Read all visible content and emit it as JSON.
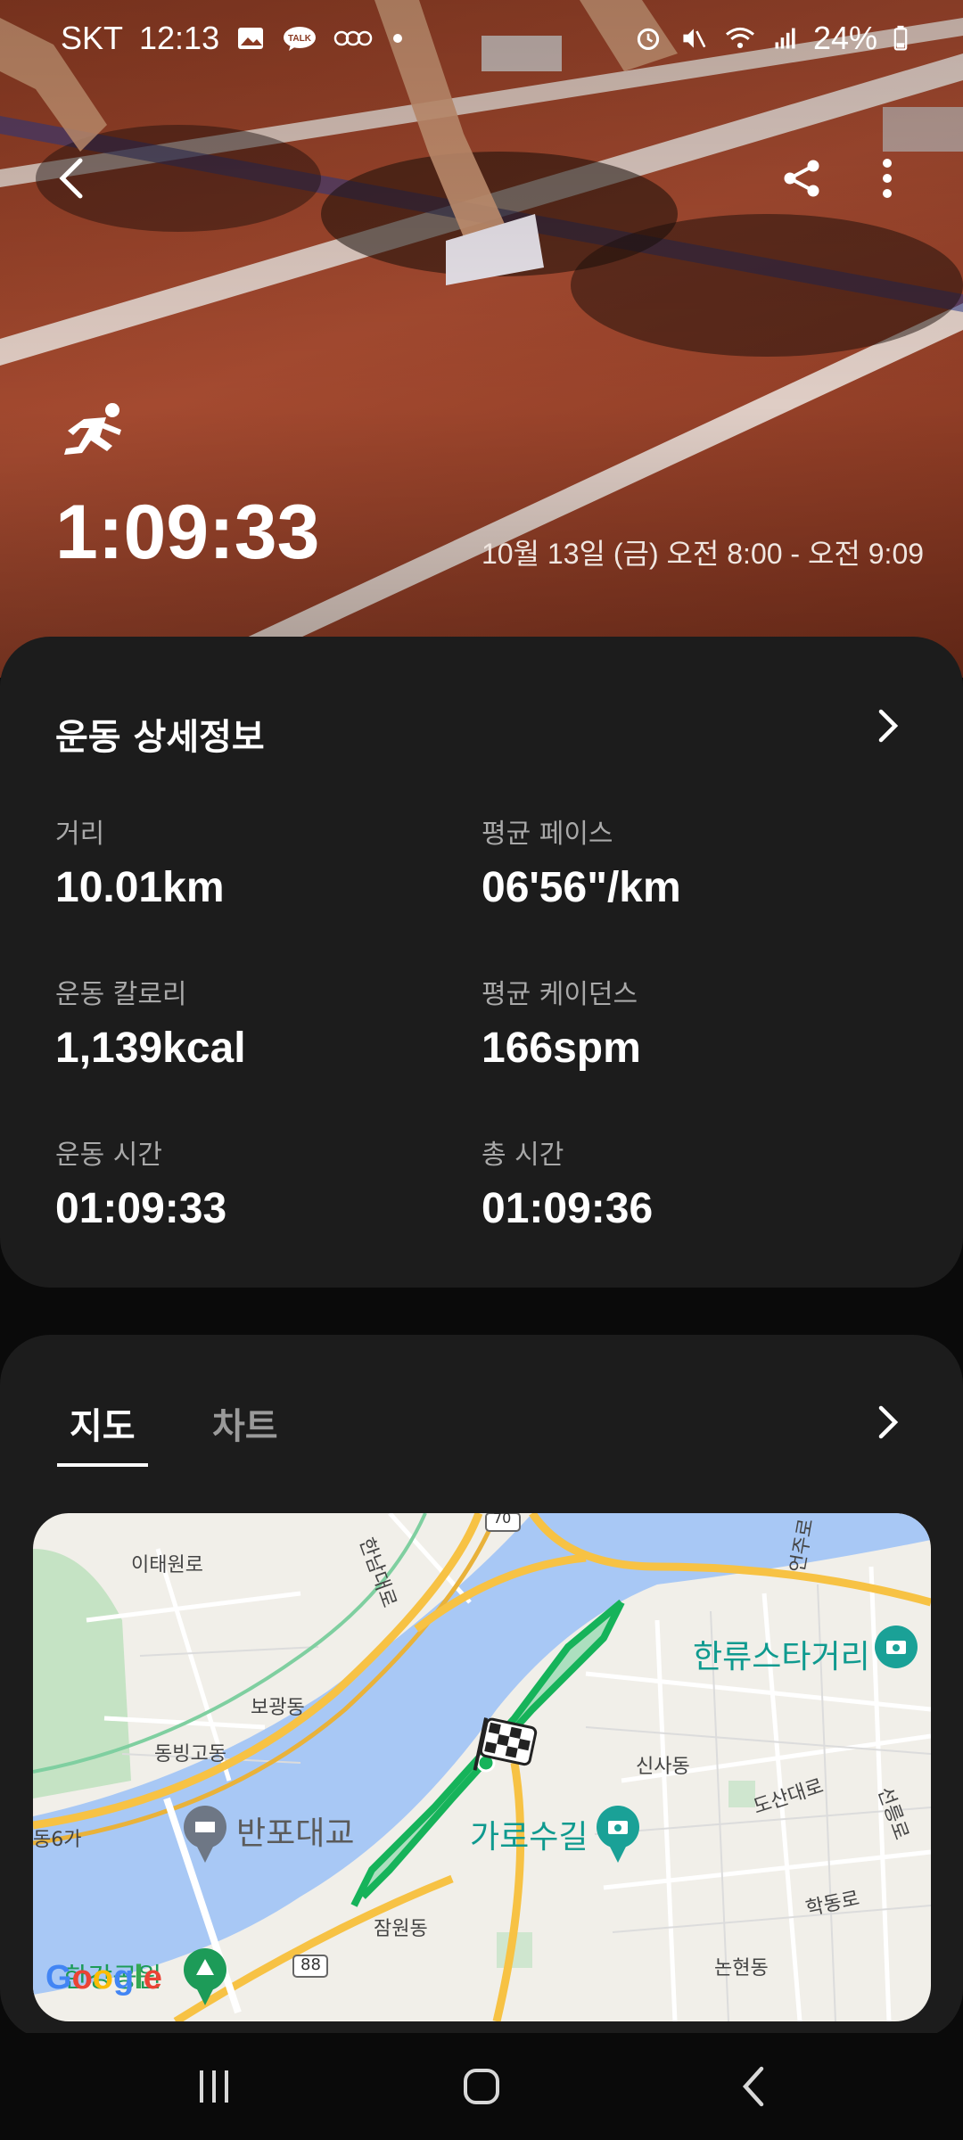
{
  "status_bar": {
    "carrier": "SKT",
    "time": "12:13",
    "battery": "24%",
    "left_icons": [
      "gallery-icon",
      "kakaotalk-icon",
      "ooo-icon",
      "dot-icon"
    ],
    "right_icons": [
      "alarm-icon",
      "mute-icon",
      "wifi-icon",
      "signal-icon",
      "battery-icon"
    ]
  },
  "hero": {
    "activity_icon": "running-icon",
    "duration": "1:09:33",
    "date_range": "10월 13일 (금) 오전 8:00 - 오전 9:09"
  },
  "details": {
    "title": "운동 상세정보",
    "metrics": [
      {
        "label": "거리",
        "value": "10.01",
        "unit": "km"
      },
      {
        "label": "평균 페이스",
        "value": "06'56\"/km",
        "unit": ""
      },
      {
        "label": "운동 칼로리",
        "value": "1,139",
        "unit": "kcal"
      },
      {
        "label": "평균 케이던스",
        "value": "166",
        "unit": "spm"
      },
      {
        "label": "운동 시간",
        "value": "01:09:33",
        "unit": ""
      },
      {
        "label": "총 시간",
        "value": "01:09:36",
        "unit": ""
      }
    ]
  },
  "map_section": {
    "tabs": [
      {
        "label": "지도",
        "active": true
      },
      {
        "label": "차트",
        "active": false
      }
    ],
    "labels": {
      "itaewon": "이태원로",
      "hannam": "한남대로",
      "bogwang": "보광동",
      "dongbinggo": "동빙고동",
      "dong6ga": "동6가",
      "banpo": "반포대교",
      "jamwon": "잠원동",
      "sinsa": "신사동",
      "garosu": "가로수길",
      "hallyu": "한류스타거리",
      "dosan": "도산대로",
      "seolleung": "선릉로",
      "hakdong": "학동로",
      "nonhyeon": "논현동",
      "eonju": "언주로",
      "park": "한강공원",
      "route70": "70",
      "route88": "88",
      "google": "Google"
    }
  },
  "colors": {
    "card_bg": "#1c1c1c",
    "page_bg": "#0a0a0a",
    "route": "#16b35a",
    "water": "#a8c8f5",
    "road_major": "#f7c244"
  }
}
